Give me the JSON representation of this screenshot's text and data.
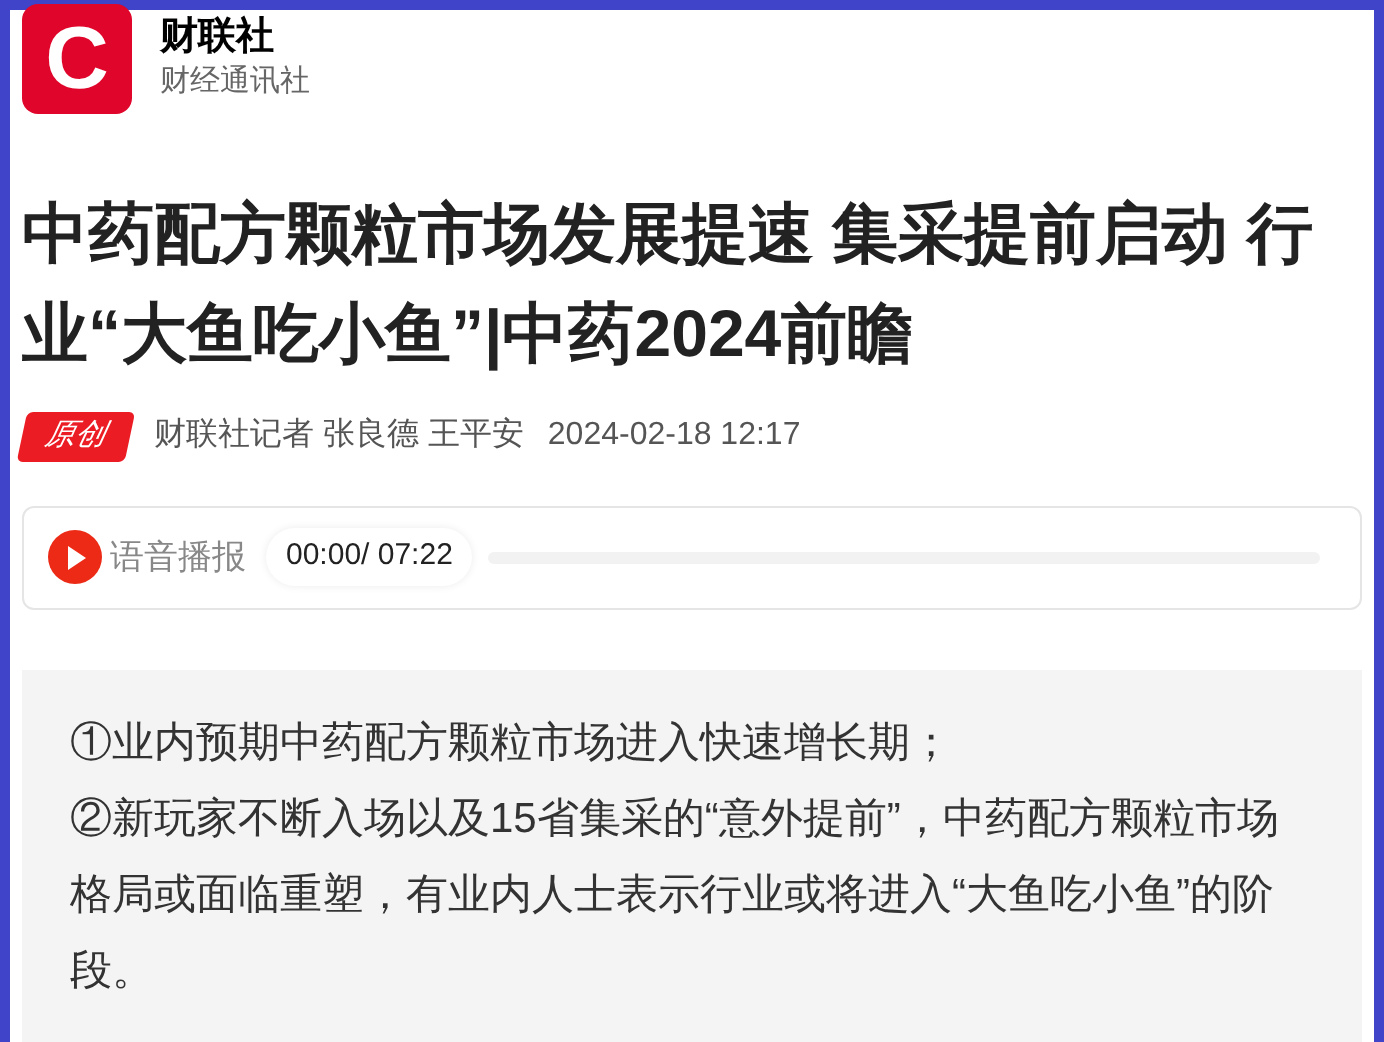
{
  "source": {
    "logo_letter": "C",
    "name": "财联社",
    "subtitle": "财经通讯社"
  },
  "headline": "中药配方颗粒市场发展提速 集采提前启动 行业“大鱼吃小鱼”|中药2024前瞻",
  "meta": {
    "badge": "原创",
    "authors": "财联社记者 张良德 王平安",
    "time": "2024-02-18 12:17"
  },
  "audio": {
    "label": "语音播报",
    "time": "00:00/ 07:22"
  },
  "summary": [
    "①业内预期中药配方颗粒市场进入快速增长期；",
    "②新玩家不断入场以及15省集采的“意外提前”，中药配方颗粒市场格局或面临重塑，有业内人士表示行业或将进入“大鱼吃小鱼”的阶段。"
  ]
}
